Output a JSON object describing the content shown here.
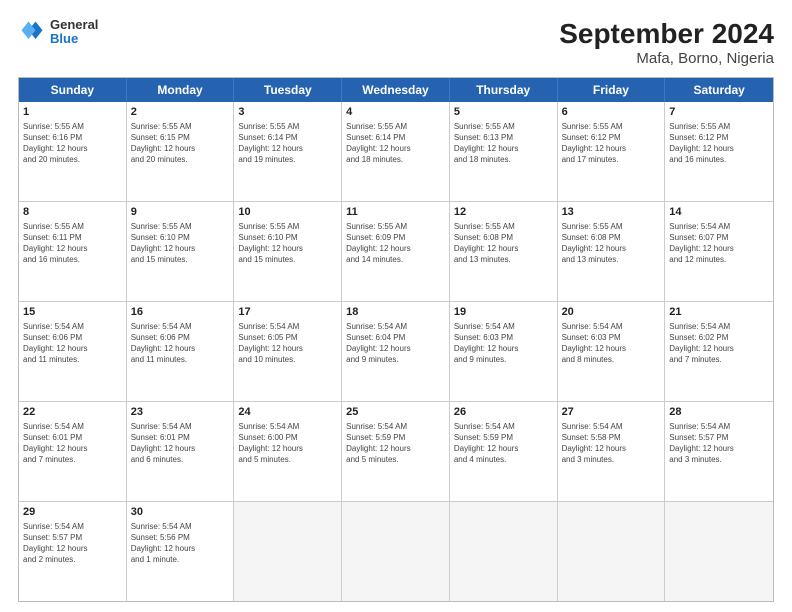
{
  "header": {
    "logo": {
      "line1": "General",
      "line2": "Blue"
    },
    "title": "September 2024",
    "subtitle": "Mafa, Borno, Nigeria"
  },
  "weekdays": [
    "Sunday",
    "Monday",
    "Tuesday",
    "Wednesday",
    "Thursday",
    "Friday",
    "Saturday"
  ],
  "rows": [
    [
      {
        "day": "",
        "info": ""
      },
      {
        "day": "2",
        "info": "Sunrise: 5:55 AM\nSunset: 6:15 PM\nDaylight: 12 hours\nand 20 minutes."
      },
      {
        "day": "3",
        "info": "Sunrise: 5:55 AM\nSunset: 6:14 PM\nDaylight: 12 hours\nand 19 minutes."
      },
      {
        "day": "4",
        "info": "Sunrise: 5:55 AM\nSunset: 6:14 PM\nDaylight: 12 hours\nand 18 minutes."
      },
      {
        "day": "5",
        "info": "Sunrise: 5:55 AM\nSunset: 6:13 PM\nDaylight: 12 hours\nand 18 minutes."
      },
      {
        "day": "6",
        "info": "Sunrise: 5:55 AM\nSunset: 6:12 PM\nDaylight: 12 hours\nand 17 minutes."
      },
      {
        "day": "7",
        "info": "Sunrise: 5:55 AM\nSunset: 6:12 PM\nDaylight: 12 hours\nand 16 minutes."
      }
    ],
    [
      {
        "day": "1",
        "info": "Sunrise: 5:55 AM\nSunset: 6:16 PM\nDaylight: 12 hours\nand 20 minutes."
      },
      {
        "day": "9",
        "info": "Sunrise: 5:55 AM\nSunset: 6:10 PM\nDaylight: 12 hours\nand 15 minutes."
      },
      {
        "day": "10",
        "info": "Sunrise: 5:55 AM\nSunset: 6:10 PM\nDaylight: 12 hours\nand 15 minutes."
      },
      {
        "day": "11",
        "info": "Sunrise: 5:55 AM\nSunset: 6:09 PM\nDaylight: 12 hours\nand 14 minutes."
      },
      {
        "day": "12",
        "info": "Sunrise: 5:55 AM\nSunset: 6:08 PM\nDaylight: 12 hours\nand 13 minutes."
      },
      {
        "day": "13",
        "info": "Sunrise: 5:55 AM\nSunset: 6:08 PM\nDaylight: 12 hours\nand 13 minutes."
      },
      {
        "day": "14",
        "info": "Sunrise: 5:54 AM\nSunset: 6:07 PM\nDaylight: 12 hours\nand 12 minutes."
      }
    ],
    [
      {
        "day": "8",
        "info": "Sunrise: 5:55 AM\nSunset: 6:11 PM\nDaylight: 12 hours\nand 16 minutes."
      },
      {
        "day": "16",
        "info": "Sunrise: 5:54 AM\nSunset: 6:06 PM\nDaylight: 12 hours\nand 11 minutes."
      },
      {
        "day": "17",
        "info": "Sunrise: 5:54 AM\nSunset: 6:05 PM\nDaylight: 12 hours\nand 10 minutes."
      },
      {
        "day": "18",
        "info": "Sunrise: 5:54 AM\nSunset: 6:04 PM\nDaylight: 12 hours\nand 9 minutes."
      },
      {
        "day": "19",
        "info": "Sunrise: 5:54 AM\nSunset: 6:03 PM\nDaylight: 12 hours\nand 9 minutes."
      },
      {
        "day": "20",
        "info": "Sunrise: 5:54 AM\nSunset: 6:03 PM\nDaylight: 12 hours\nand 8 minutes."
      },
      {
        "day": "21",
        "info": "Sunrise: 5:54 AM\nSunset: 6:02 PM\nDaylight: 12 hours\nand 7 minutes."
      }
    ],
    [
      {
        "day": "15",
        "info": "Sunrise: 5:54 AM\nSunset: 6:06 PM\nDaylight: 12 hours\nand 11 minutes."
      },
      {
        "day": "23",
        "info": "Sunrise: 5:54 AM\nSunset: 6:01 PM\nDaylight: 12 hours\nand 6 minutes."
      },
      {
        "day": "24",
        "info": "Sunrise: 5:54 AM\nSunset: 6:00 PM\nDaylight: 12 hours\nand 5 minutes."
      },
      {
        "day": "25",
        "info": "Sunrise: 5:54 AM\nSunset: 5:59 PM\nDaylight: 12 hours\nand 5 minutes."
      },
      {
        "day": "26",
        "info": "Sunrise: 5:54 AM\nSunset: 5:59 PM\nDaylight: 12 hours\nand 4 minutes."
      },
      {
        "day": "27",
        "info": "Sunrise: 5:54 AM\nSunset: 5:58 PM\nDaylight: 12 hours\nand 3 minutes."
      },
      {
        "day": "28",
        "info": "Sunrise: 5:54 AM\nSunset: 5:57 PM\nDaylight: 12 hours\nand 3 minutes."
      }
    ],
    [
      {
        "day": "22",
        "info": "Sunrise: 5:54 AM\nSunset: 6:01 PM\nDaylight: 12 hours\nand 7 minutes."
      },
      {
        "day": "30",
        "info": "Sunrise: 5:54 AM\nSunset: 5:56 PM\nDaylight: 12 hours\nand 1 minute."
      },
      {
        "day": "",
        "info": ""
      },
      {
        "day": "",
        "info": ""
      },
      {
        "day": "",
        "info": ""
      },
      {
        "day": "",
        "info": ""
      },
      {
        "day": "",
        "info": ""
      }
    ],
    [
      {
        "day": "29",
        "info": "Sunrise: 5:54 AM\nSunset: 5:57 PM\nDaylight: 12 hours\nand 2 minutes."
      },
      {
        "day": "",
        "info": ""
      },
      {
        "day": "",
        "info": ""
      },
      {
        "day": "",
        "info": ""
      },
      {
        "day": "",
        "info": ""
      },
      {
        "day": "",
        "info": ""
      },
      {
        "day": "",
        "info": ""
      }
    ]
  ],
  "colors": {
    "header_bg": "#2563b0",
    "header_text": "#ffffff",
    "cell_border": "#cccccc"
  }
}
